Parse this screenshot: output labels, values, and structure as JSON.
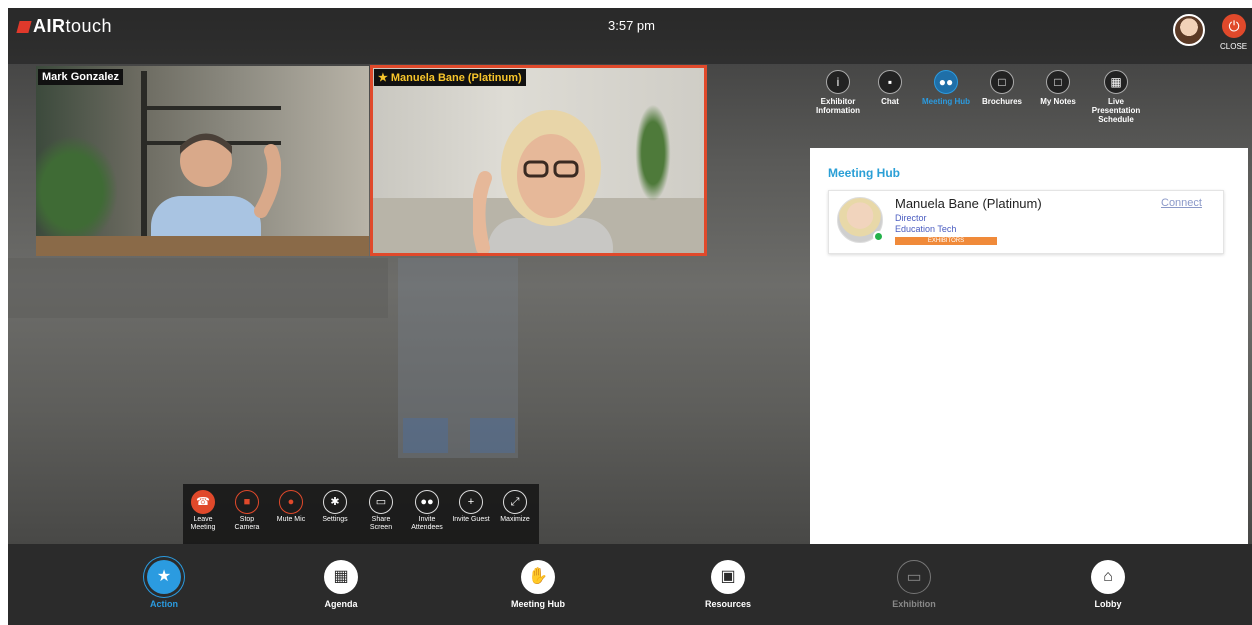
{
  "app": {
    "logo_brand": "AIR",
    "logo_rest": "touch",
    "time": "3:57 pm",
    "close_label": "CLOSE"
  },
  "videos": [
    {
      "name": "Mark Gonzalez"
    },
    {
      "name": "Manuela Bane (Platinum)"
    }
  ],
  "side_tabs": [
    {
      "label": "Exhibitor Information",
      "icon": "info-icon"
    },
    {
      "label": "Chat",
      "icon": "chat-icon"
    },
    {
      "label": "Meeting Hub",
      "icon": "people-icon",
      "active": true
    },
    {
      "label": "Brochures",
      "icon": "note-icon"
    },
    {
      "label": "My Notes",
      "icon": "note-icon"
    },
    {
      "label": "Live Presentation Schedule",
      "icon": "schedule-icon"
    }
  ],
  "panel": {
    "title": "Meeting Hub",
    "contact": {
      "name": "Manuela Bane (Platinum)",
      "role": "Director",
      "company": "Education Tech",
      "badge": "EXHIBITORS",
      "action": "Connect",
      "status_color": "#24b24b"
    }
  },
  "controls": [
    {
      "label": "Leave Meeting",
      "icon": "phone-icon"
    },
    {
      "label": "Stop Camera",
      "icon": "camera-icon"
    },
    {
      "label": "Mute Mic",
      "icon": "mic-icon"
    },
    {
      "label": "Settings",
      "icon": "gear-icon"
    },
    {
      "label": "Share Screen",
      "icon": "monitor-icon"
    },
    {
      "label": "Invite Attendees",
      "icon": "group-icon"
    },
    {
      "label": "Invite Guest",
      "icon": "add-user-icon"
    },
    {
      "label": "Maximize",
      "icon": "expand-icon"
    }
  ],
  "bottom_nav": [
    {
      "label": "Action",
      "icon": "star-icon",
      "active": true
    },
    {
      "label": "Agenda",
      "icon": "calendar-icon"
    },
    {
      "label": "Meeting Hub",
      "icon": "handshake-icon"
    },
    {
      "label": "Resources",
      "icon": "images-icon"
    },
    {
      "label": "Exhibition",
      "icon": "laptop-icon",
      "disabled": true
    },
    {
      "label": "Lobby",
      "icon": "home-icon"
    }
  ],
  "colors": {
    "accent": "#2b9be0",
    "danger": "#e0492b",
    "badge": "#f08a3a"
  }
}
